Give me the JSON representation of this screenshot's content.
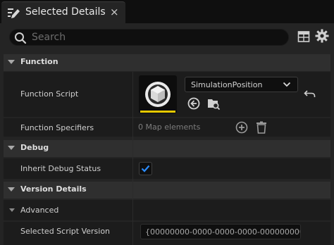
{
  "tab": {
    "title": "Selected Details",
    "close_glyph": "×"
  },
  "search": {
    "placeholder": "Search",
    "value": ""
  },
  "toolbar": {
    "table_icon": "table-view-icon",
    "settings_icon": "gear-icon"
  },
  "categories": {
    "function": "Function",
    "debug": "Debug",
    "version_details": "Version Details"
  },
  "properties": {
    "function_script": {
      "label": "Function Script",
      "value": "SimulationPosition"
    },
    "function_specifiers": {
      "label": "Function Specifiers",
      "value": "0 Map elements"
    },
    "inherit_debug_status": {
      "label": "Inherit Debug Status",
      "checked": true
    },
    "advanced": {
      "label": "Advanced"
    },
    "selected_script_version": {
      "label": "Selected Script Version",
      "value": "{00000000-0000-0000-0000-0000000000"
    }
  },
  "colors": {
    "accent_yellow": "#e6c900",
    "checkbox_blue": "#2b8cff",
    "background": "#242424"
  }
}
